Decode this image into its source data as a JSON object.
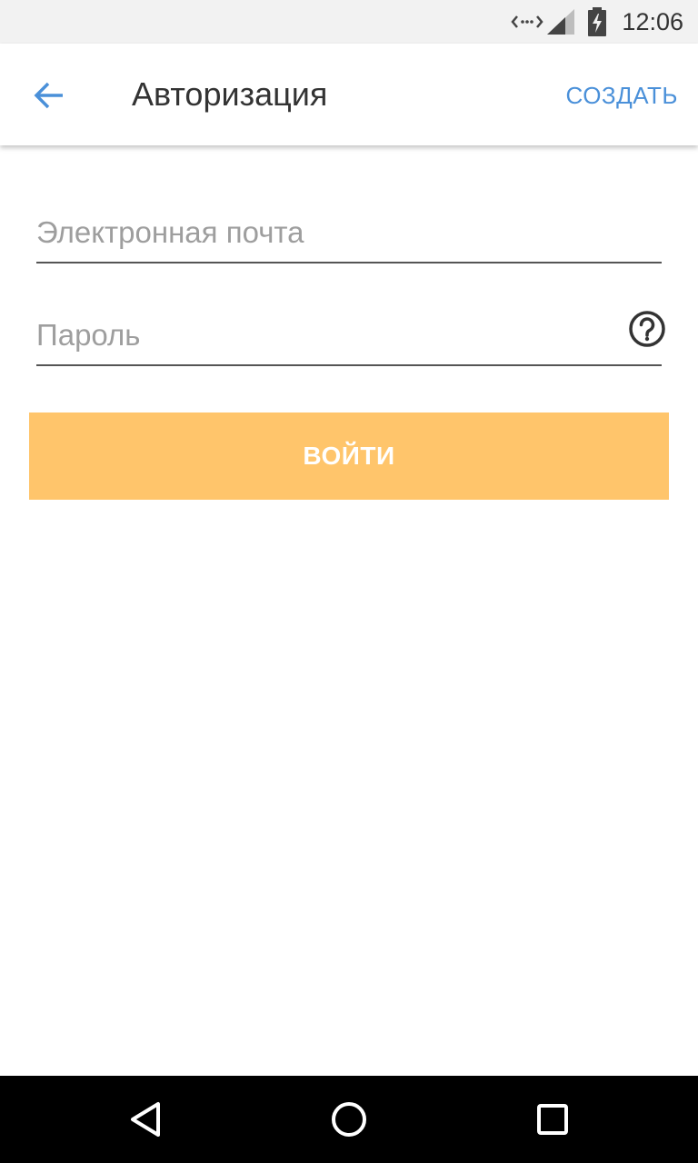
{
  "status_bar": {
    "time": "12:06",
    "icons": [
      "data-transfer-icon",
      "signal-icon",
      "battery-charging-icon"
    ]
  },
  "app_bar": {
    "back_icon": "arrow-back-icon",
    "title": "Авторизация",
    "action_label": "СОЗДАТЬ",
    "action_color": "#4a90d9"
  },
  "form": {
    "email": {
      "value": "",
      "placeholder": "Электронная почта"
    },
    "password": {
      "value": "",
      "placeholder": "Пароль",
      "help_icon": "help-circle-icon"
    },
    "submit_label": "ВОЙТИ",
    "submit_color": "#ffc56b"
  },
  "nav_bar": {
    "buttons": [
      "back-triangle-icon",
      "home-circle-icon",
      "recents-square-icon"
    ]
  }
}
